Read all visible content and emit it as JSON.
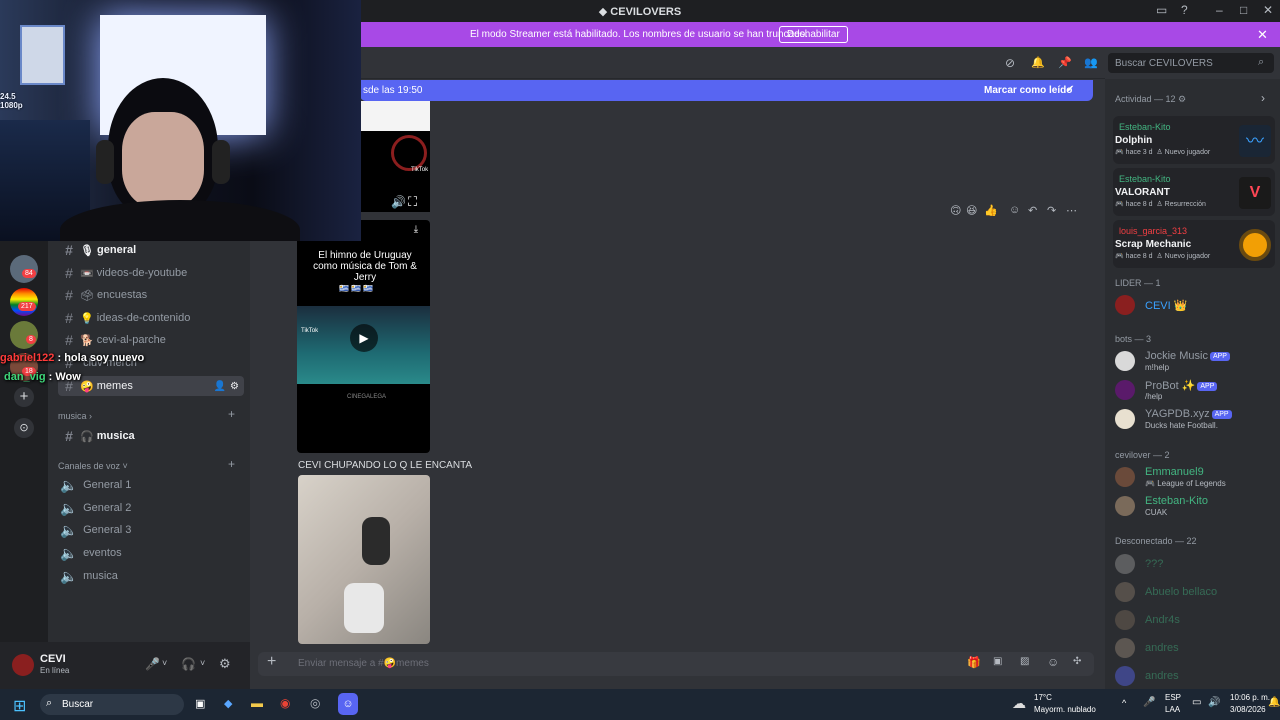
{
  "window": {
    "title": "CEVILOVERS"
  },
  "banner": {
    "text": "El modo Streamer está habilitado. Los nombres de usuario se han truncado.",
    "button": "Deshabilitar"
  },
  "servers": [
    {
      "badge": "84"
    },
    {
      "badge": "217"
    },
    {
      "badge": "8"
    },
    {
      "badge": "18"
    }
  ],
  "sidebar": {
    "channels": [
      {
        "emoji": "🎙",
        "label": "general",
        "bold": true
      },
      {
        "emoji": "📼",
        "label": "videos-de-youtube"
      },
      {
        "emoji": "🗳",
        "label": "encuestas"
      },
      {
        "emoji": "💡",
        "label": "ideas-de-contenido"
      },
      {
        "emoji": "🐕",
        "label": "cevi-al-parche"
      },
      {
        "emoji": "",
        "label": "cluv-merch"
      },
      {
        "emoji": "🤪",
        "label": "memes",
        "active": true
      }
    ],
    "cat_musica": "musica",
    "musica_channel": {
      "emoji": "🎧",
      "label": "musica"
    },
    "cat_voz": "Canales de voz",
    "voice": [
      "General 1",
      "General 2",
      "General 3",
      "eventos",
      "musica"
    ]
  },
  "user": {
    "name": "CEVI",
    "status": "En línea"
  },
  "chat": {
    "new_since": "sde las 19:50",
    "mark_read": "Marcar como leído",
    "video1": {
      "title": "El himno de Uruguay como música de Tom & Jerry",
      "flags": "🇺🇾 🇺🇾 🇺🇾",
      "tiktok": "TikTok",
      "watermark": "CINEGALEGA"
    },
    "message": "CEVI CHUPANDO LO Q LE ENCANTA",
    "input_placeholder": "Enviar mensaje a #🤪memes"
  },
  "search": {
    "placeholder": "Buscar CEVILOVERS"
  },
  "members": {
    "activity_header": "Actividad — 12",
    "activities": [
      {
        "who": "Esteban-Kito",
        "game": "Dolphin",
        "time": "hace 3 d",
        "tag": "Nuevo jugador",
        "color": "#3aa1ff"
      },
      {
        "who": "Esteban-Kito",
        "game": "VALORANT",
        "time": "hace 8 d",
        "tag": "Resurrección",
        "color": "#ff4655"
      },
      {
        "who": "louis_garcia_313",
        "game": "Scrap Mechanic",
        "time": "hace 8 d",
        "tag": "Nuevo jugador",
        "color": "#f29f05"
      }
    ],
    "lider_header": "LIDER — 1",
    "lider": [
      {
        "name": "CEVI 👑",
        "color": "#3aa1ff"
      }
    ],
    "bots_header": "bots — 3",
    "bots": [
      {
        "name": "Jockie Music",
        "status": "m!help",
        "badge": "APP"
      },
      {
        "name": "ProBot ✨",
        "status": "/help",
        "badge": "APP"
      },
      {
        "name": "YAGPDB.xyz",
        "status": "Ducks hate Football.",
        "badge": "APP"
      }
    ],
    "cevilover_header": "cevilover — 2",
    "cevilovers": [
      {
        "name": "Emmanuel9",
        "status": "League of Legends"
      },
      {
        "name": "Esteban-Kito",
        "status": "CUAK"
      }
    ],
    "offline_header": "Desconectado — 22",
    "offline": [
      "???",
      "Abuelo bellaco",
      "Andr4s",
      "andres",
      "andres"
    ]
  },
  "overlay": {
    "msg1_user": "gabriel122",
    "msg1_text": "hola soy nuevo",
    "msg2_user": "dan_vig",
    "msg2_text": "Wow"
  },
  "webcam": {
    "fps_line1": "24.5",
    "fps_line2": "1080p"
  },
  "taskbar": {
    "search": "Buscar",
    "temp": "17°C",
    "weather": "Mayorm. nublado",
    "lang1": "ESP",
    "lang2": "LAA",
    "time": "10:06 p. m.",
    "date": "3/08/2026"
  }
}
